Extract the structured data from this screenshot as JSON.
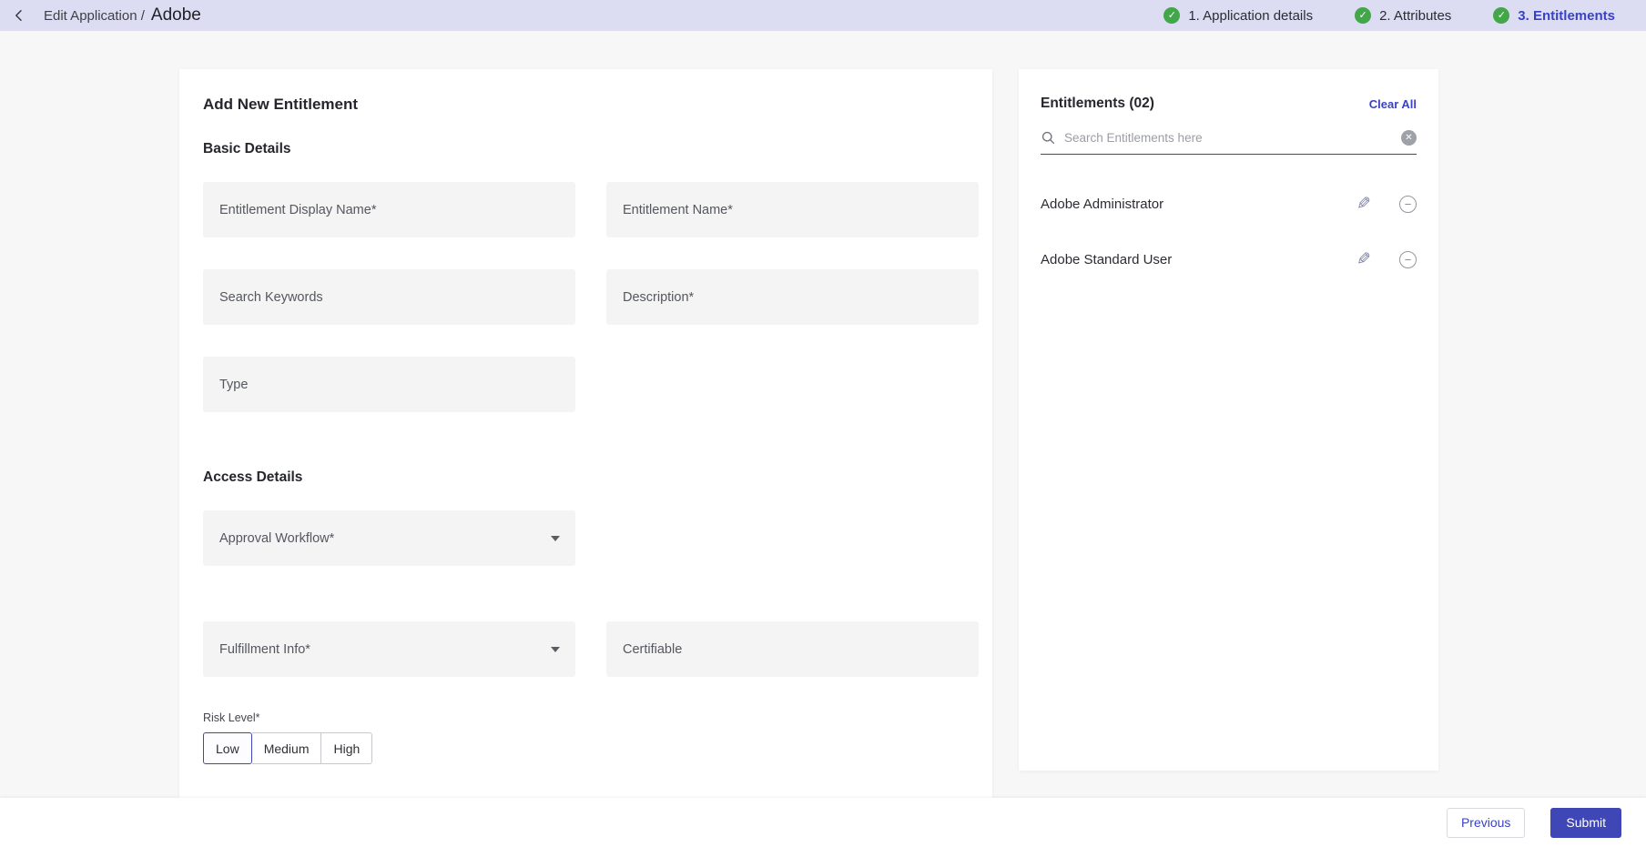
{
  "header": {
    "breadcrumb_prefix": "Edit Application /",
    "app_name": "Adobe",
    "steps": [
      {
        "label": "1. Application details",
        "state": "done"
      },
      {
        "label": "2. Attributes",
        "state": "done"
      },
      {
        "label": "3. Entitlements",
        "state": "active"
      }
    ]
  },
  "form": {
    "title": "Add New Entitlement",
    "sections": {
      "basic": "Basic Details",
      "access": "Access Details"
    },
    "fields": {
      "display_name": "Entitlement Display Name*",
      "name": "Entitlement Name*",
      "keywords": "Search Keywords",
      "description": "Description*",
      "type": "Type",
      "approval_workflow": "Approval Workflow*",
      "fulfillment_info": "Fulfillment Info*",
      "certifiable": "Certifiable"
    },
    "risk": {
      "label": "Risk Level*",
      "options": [
        "Low",
        "Medium",
        "High"
      ],
      "selected": "Low"
    }
  },
  "entitlements_panel": {
    "title": "Entitlements (02)",
    "clear_all_label": "Clear All",
    "search_placeholder": "Search Entitlements here",
    "search_value": "",
    "items": [
      {
        "name": "Adobe Administrator"
      },
      {
        "name": "Adobe Standard User"
      }
    ]
  },
  "footer": {
    "previous_label": "Previous",
    "submit_label": "Submit"
  },
  "colors": {
    "accent": "#3f46b5",
    "accent_strong": "#3a42c4",
    "success": "#43a649",
    "header_bg": "#dcddf3"
  }
}
